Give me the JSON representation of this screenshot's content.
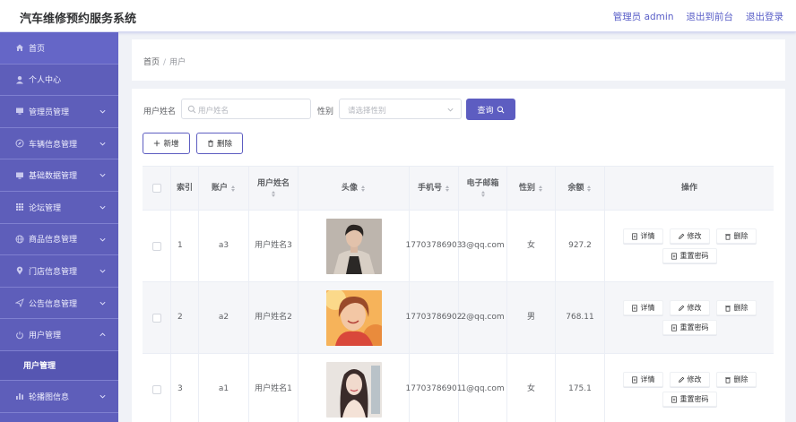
{
  "header": {
    "title": "汽车维修预约服务系统",
    "admin_label": "管理员 admin",
    "front_label": "退出到前台",
    "logout_label": "退出登录"
  },
  "sidebar": {
    "items": [
      {
        "label": "首页",
        "icon": "home-icon"
      },
      {
        "label": "个人中心",
        "icon": "user-icon"
      },
      {
        "label": "管理员管理",
        "icon": "monitor-icon"
      },
      {
        "label": "车辆信息管理",
        "icon": "compass-icon"
      },
      {
        "label": "基础数据管理",
        "icon": "monitor-icon"
      },
      {
        "label": "论坛管理",
        "icon": "grid-icon"
      },
      {
        "label": "商品信息管理",
        "icon": "globe-icon"
      },
      {
        "label": "门店信息管理",
        "icon": "pin-icon"
      },
      {
        "label": "公告信息管理",
        "icon": "send-icon"
      },
      {
        "label": "用户管理",
        "icon": "power-icon"
      }
    ],
    "sub_item": "用户管理",
    "last_item": {
      "label": "轮播图信息",
      "icon": "chart-icon"
    }
  },
  "breadcrumb": {
    "home": "首页",
    "separator": "/",
    "current": "用户"
  },
  "filters": {
    "name_label": "用户姓名",
    "name_placeholder": "用户姓名",
    "gender_label": "性别",
    "gender_placeholder": "请选择性别",
    "query_label": "查询"
  },
  "actions": {
    "add_label": "新增",
    "delete_label": "删除"
  },
  "table": {
    "columns": [
      "索引",
      "账户",
      "用户姓名",
      "头像",
      "手机号",
      "电子邮箱",
      "性别",
      "余额",
      "操作"
    ],
    "op_labels": {
      "detail": "详情",
      "edit": "修改",
      "delete": "删除",
      "reset": "重置密码"
    },
    "rows": [
      {
        "index": "1",
        "account": "a3",
        "name": "用户姓名3",
        "phone": "17703786903",
        "email": "3@qq.com",
        "gender": "女",
        "balance": "927.2"
      },
      {
        "index": "2",
        "account": "a2",
        "name": "用户姓名2",
        "phone": "17703786902",
        "email": "2@qq.com",
        "gender": "男",
        "balance": "768.11"
      },
      {
        "index": "3",
        "account": "a1",
        "name": "用户姓名1",
        "phone": "17703786901",
        "email": "1@qq.com",
        "gender": "女",
        "balance": "175.1"
      }
    ]
  },
  "colors": {
    "brand": "#5d5dc1",
    "sidebar": "#5f5fbd",
    "divider": "#7f80d0"
  }
}
